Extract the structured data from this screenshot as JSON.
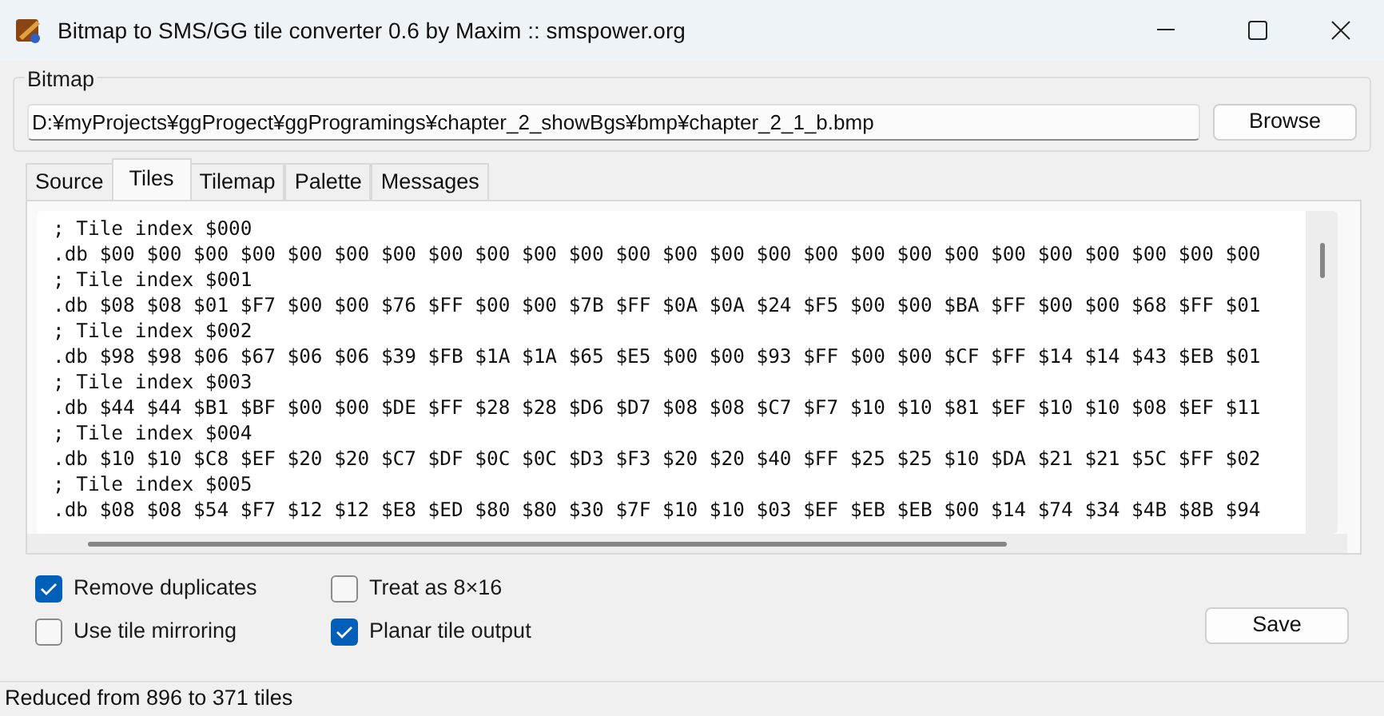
{
  "window": {
    "title": "Bitmap to SMS/GG tile converter 0.6 by Maxim :: smspower.org"
  },
  "bitmap": {
    "label": "Bitmap",
    "path": "D:¥myProjects¥ggProgect¥ggProgramings¥chapter_2_showBgs¥bmp¥chapter_2_1_b.bmp",
    "browse": "Browse"
  },
  "tabs": [
    {
      "label": "Source",
      "selected": false
    },
    {
      "label": "Tiles",
      "selected": true
    },
    {
      "label": "Tilemap",
      "selected": false
    },
    {
      "label": "Palette",
      "selected": false
    },
    {
      "label": "Messages",
      "selected": false
    }
  ],
  "output_lines": [
    "; Tile index $000",
    ".db $00 $00 $00 $00 $00 $00 $00 $00 $00 $00 $00 $00 $00 $00 $00 $00 $00 $00 $00 $00 $00 $00 $00 $00 $00",
    "; Tile index $001",
    ".db $08 $08 $01 $F7 $00 $00 $76 $FF $00 $00 $7B $FF $0A $0A $24 $F5 $00 $00 $BA $FF $00 $00 $68 $FF $01",
    "; Tile index $002",
    ".db $98 $98 $06 $67 $06 $06 $39 $FB $1A $1A $65 $E5 $00 $00 $93 $FF $00 $00 $CF $FF $14 $14 $43 $EB $01",
    "; Tile index $003",
    ".db $44 $44 $B1 $BF $00 $00 $DE $FF $28 $28 $D6 $D7 $08 $08 $C7 $F7 $10 $10 $81 $EF $10 $10 $08 $EF $11",
    "; Tile index $004",
    ".db $10 $10 $C8 $EF $20 $20 $C7 $DF $0C $0C $D3 $F3 $20 $20 $40 $FF $25 $25 $10 $DA $21 $21 $5C $FF $02",
    "; Tile index $005",
    ".db $08 $08 $54 $F7 $12 $12 $E8 $ED $80 $80 $30 $7F $10 $10 $03 $EF $EB $EB $00 $14 $74 $34 $4B $8B $94"
  ],
  "options": [
    {
      "label": "Remove duplicates",
      "checked": true
    },
    {
      "label": "Treat as 8×16",
      "checked": false
    },
    {
      "label": "Use tile mirroring",
      "checked": false
    },
    {
      "label": "Planar tile output",
      "checked": true
    }
  ],
  "save": "Save",
  "status_bar": "Reduced from 896 to 371 tiles"
}
